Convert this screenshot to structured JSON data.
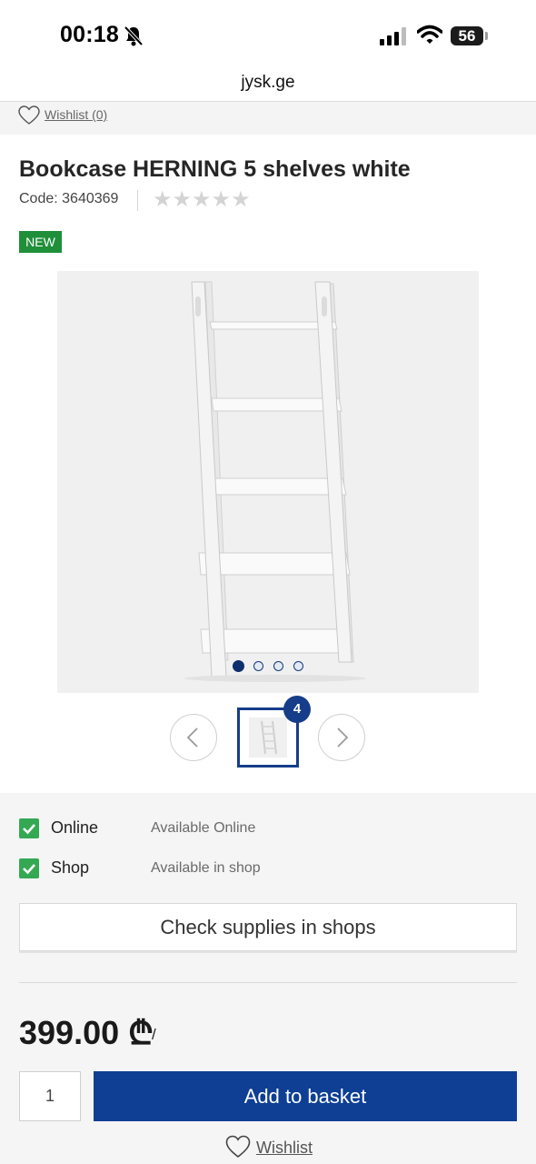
{
  "status_bar": {
    "time": "00:18",
    "battery": "56"
  },
  "browser": {
    "url": "jysk.ge"
  },
  "top_wishlist": {
    "label": "Wishlist (0)"
  },
  "product": {
    "title": "Bookcase HERNING 5 shelves white",
    "code": "Code: 3640369",
    "rating_stars": "★★★★★",
    "rating": 0,
    "badge": "NEW",
    "image_count": "4",
    "gallery": {
      "total_images": 4,
      "active_index": 1
    }
  },
  "availability": {
    "items": [
      {
        "label": "Online",
        "status": "Available Online",
        "checked": true
      },
      {
        "label": "Shop",
        "status": "Available in shop",
        "checked": true
      }
    ],
    "check_button": "Check supplies in shops"
  },
  "purchase": {
    "price": "399.00 ₾",
    "unit": "/",
    "quantity": "1",
    "add_button": "Add to basket",
    "wishlist": "Wishlist"
  },
  "colors": {
    "accent": "#0e3f94",
    "badge": "#1f8f3a",
    "check": "#34a853"
  }
}
